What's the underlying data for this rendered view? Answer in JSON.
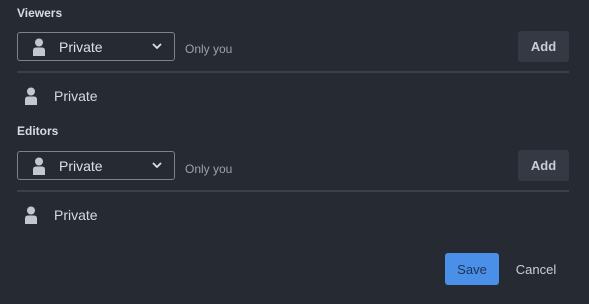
{
  "sections": [
    {
      "title": "Viewers",
      "select_value": "Private",
      "hint": "Only you",
      "add_label": "Add",
      "members": [
        {
          "label": "Private",
          "icon": "person-icon"
        }
      ]
    },
    {
      "title": "Editors",
      "select_value": "Private",
      "hint": "Only you",
      "add_label": "Add",
      "members": [
        {
          "label": "Private",
          "icon": "person-icon"
        }
      ]
    }
  ],
  "footer": {
    "save_label": "Save",
    "cancel_label": "Cancel"
  },
  "colors": {
    "background": "#262a33",
    "primary": "#4a90e8",
    "button": "#343944"
  }
}
